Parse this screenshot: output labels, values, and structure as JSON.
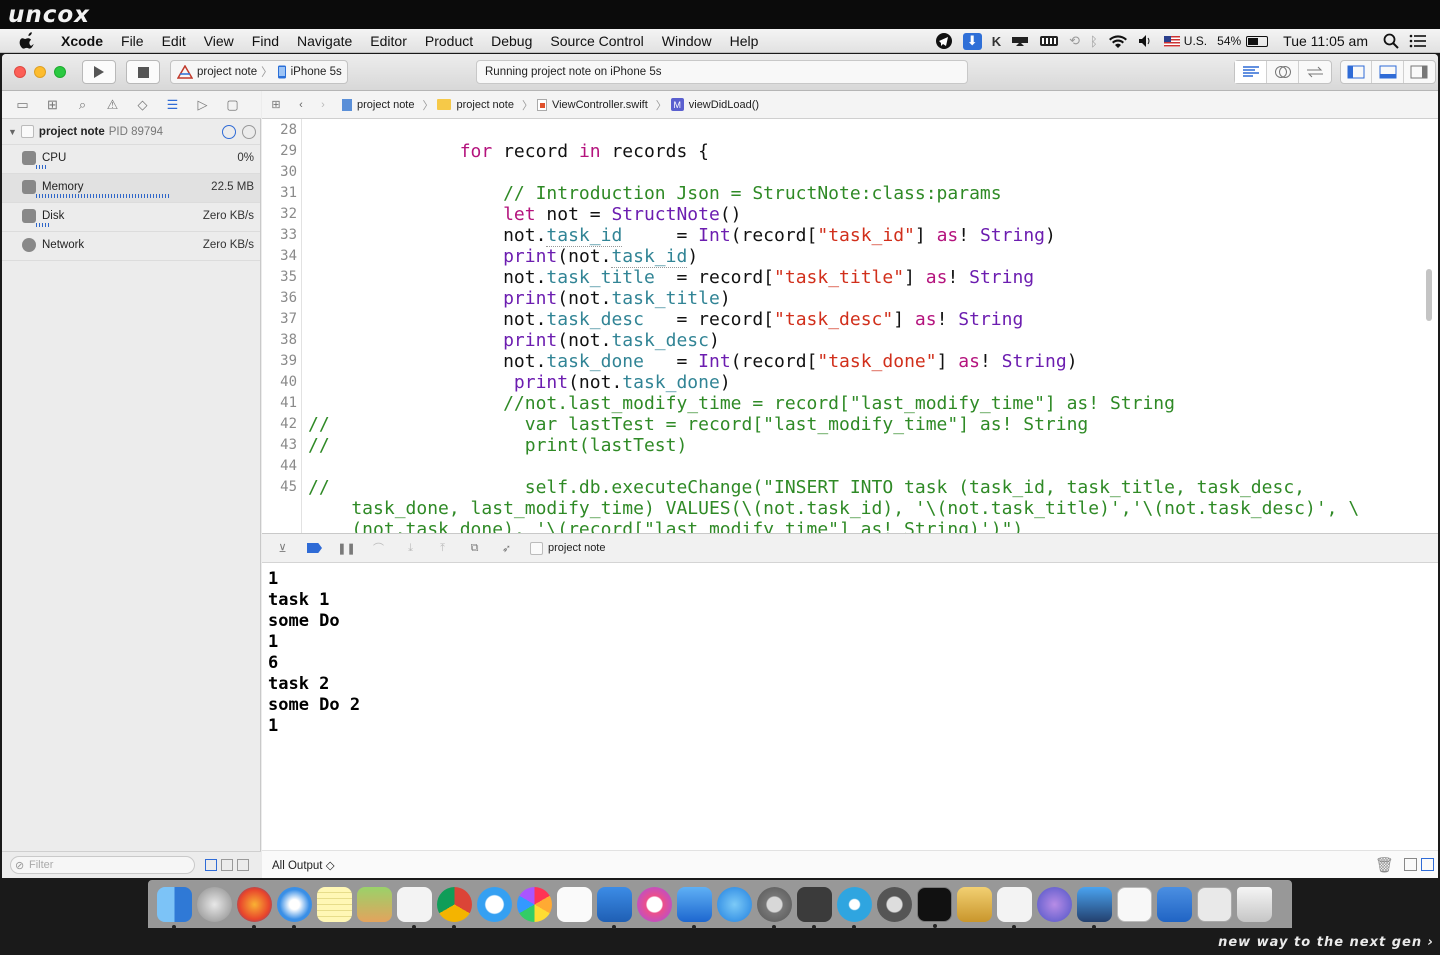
{
  "watermark": "uncox",
  "tagline": "new way to the next gen ›",
  "menubar": {
    "app": "Xcode",
    "items": [
      "File",
      "Edit",
      "View",
      "Find",
      "Navigate",
      "Editor",
      "Product",
      "Debug",
      "Source Control",
      "Window",
      "Help"
    ],
    "status": {
      "input_source": "U.S.",
      "battery": "54%",
      "clock": "Tue 11:05 am"
    }
  },
  "toolbar": {
    "scheme_project": "project note",
    "scheme_device": "iPhone 5s",
    "activity": "Running project note on iPhone 5s"
  },
  "navigator": {
    "process": {
      "name": "project note",
      "pid": "PID 89794"
    },
    "gauges": [
      {
        "label": "CPU",
        "value": "0%"
      },
      {
        "label": "Memory",
        "value": "22.5 MB"
      },
      {
        "label": "Disk",
        "value": "Zero KB/s"
      },
      {
        "label": "Network",
        "value": "Zero KB/s"
      }
    ],
    "filter_placeholder": "Filter"
  },
  "jumpbar": {
    "crumbs": [
      "project note",
      "project note",
      "ViewController.swift",
      "viewDidLoad()"
    ]
  },
  "editor": {
    "line_numbers": [
      "28",
      "29",
      "30",
      "31",
      "32",
      "33",
      "34",
      "35",
      "36",
      "37",
      "38",
      "39",
      "40",
      "41",
      "42",
      "43",
      "44",
      "45"
    ]
  },
  "debugbar": {
    "target": "project note"
  },
  "console": {
    "lines": [
      "1",
      "task 1",
      "some Do",
      "1",
      "6",
      "task 2",
      "some Do 2",
      "1"
    ],
    "output_filter": "All Output ◇"
  },
  "dock": {
    "apps": [
      "Finder",
      "Launchpad",
      "Firefox",
      "Safari",
      "Notes",
      "Preview",
      "Java",
      "Chrome",
      "Messages",
      "Photos",
      "TextEdit",
      "Keynote",
      "iTunes",
      "Xcode",
      "App Store",
      "System Preferences",
      "Sublime Text",
      "Telegram",
      "Tor",
      "Terminal",
      "Archive Utility",
      "Java",
      "Network",
      "Simulator",
      "VLC",
      "Downloads",
      "Documents",
      "Trash"
    ]
  }
}
